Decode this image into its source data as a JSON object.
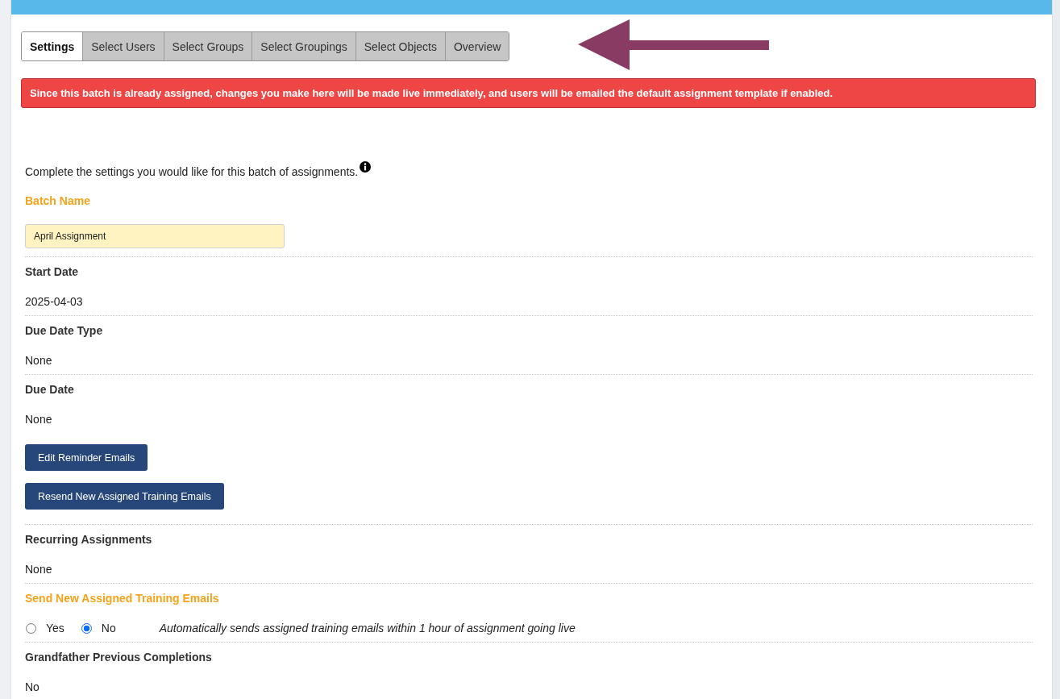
{
  "tabs": [
    {
      "label": "Settings",
      "selected": true
    },
    {
      "label": "Select Users",
      "selected": false
    },
    {
      "label": "Select Groups",
      "selected": false
    },
    {
      "label": "Select Groupings",
      "selected": false
    },
    {
      "label": "Select Objects",
      "selected": false
    },
    {
      "label": "Overview",
      "selected": false
    }
  ],
  "alert": {
    "text": "Since this batch is already assigned, changes you make here will be made live immediately, and users will be emailed the default assignment template if enabled."
  },
  "intro": {
    "text": "Complete the settings you would like for this batch of assignments."
  },
  "fields": [
    {
      "kind": "input",
      "label": "Batch Name",
      "editable": true,
      "value": "April Assignment"
    },
    {
      "kind": "text",
      "label": "Start Date",
      "editable": false,
      "value": "2025-04-03"
    },
    {
      "kind": "text",
      "label": "Due Date Type",
      "editable": false,
      "value": "None"
    },
    {
      "kind": "text",
      "label": "Due Date",
      "editable": false,
      "value": "None"
    },
    {
      "kind": "buttons",
      "buttons": [
        "Edit Reminder Emails",
        "Resend New Assigned Training Emails"
      ]
    },
    {
      "kind": "text",
      "label": "Recurring Assignments",
      "editable": false,
      "value": "None"
    },
    {
      "kind": "radio",
      "label": "Send New Assigned Training Emails",
      "editable": true,
      "options": [
        {
          "label": "Yes",
          "selected": false
        },
        {
          "label": "No",
          "selected": true
        }
      ],
      "note": "Automatically sends assigned training emails within 1 hour of assignment going live"
    },
    {
      "kind": "text",
      "label": "Grandfather Previous Completions",
      "editable": false,
      "value": "No"
    }
  ]
}
